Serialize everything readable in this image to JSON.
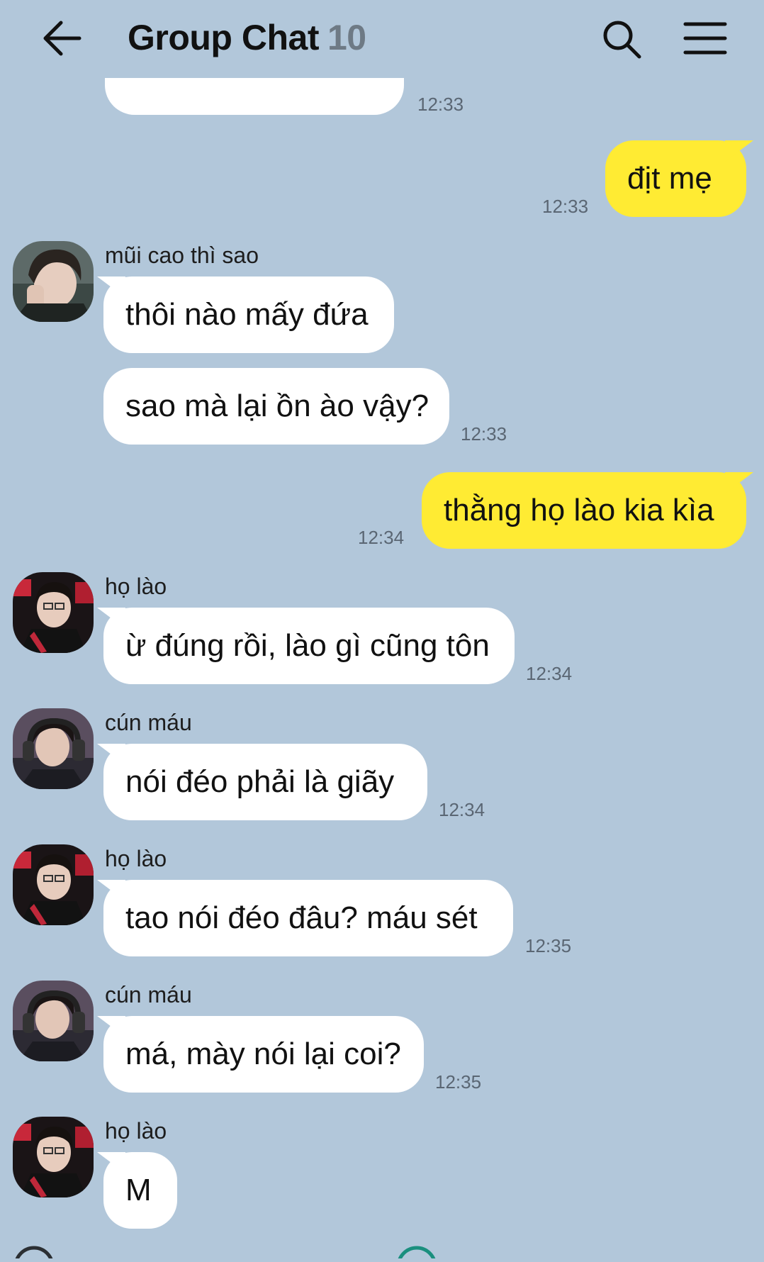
{
  "header": {
    "title": "Group Chat",
    "member_count": "10"
  },
  "messages": [
    {
      "time": "12:33"
    },
    {
      "text": "địt mẹ",
      "time": "12:33"
    },
    {
      "sender": "mũi cao thì sao",
      "text": "thôi nào mấy đứa"
    },
    {
      "text": "sao mà lại ồn ào vậy?",
      "time": "12:33"
    },
    {
      "text": "thằng họ lào kia kìa",
      "time": "12:34"
    },
    {
      "sender": "họ lào",
      "text": "ừ đúng rồi, lào gì cũng tôn",
      "time": "12:34"
    },
    {
      "sender": "cún máu",
      "text": "nói đéo phải là giãy",
      "time": "12:34"
    },
    {
      "sender": "họ lào",
      "text": "tao nói đéo đâu? máu sét",
      "time": "12:35"
    },
    {
      "sender": "cún máu",
      "text": "má, mày nói lại coi?",
      "time": "12:35"
    },
    {
      "sender": "họ lào",
      "text": "M"
    }
  ],
  "colors": {
    "background": "#b2c7da",
    "my_bubble": "#ffeb33",
    "other_bubble": "#ffffff",
    "count_text": "#6e7a85"
  }
}
